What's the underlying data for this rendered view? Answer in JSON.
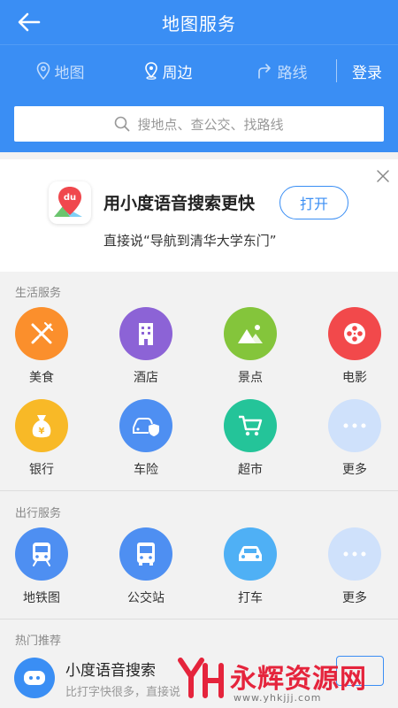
{
  "header": {
    "title": "地图服务",
    "back_icon": "arrow-left-icon"
  },
  "tabs": [
    {
      "label": "地图",
      "icon": "location-pin-icon",
      "active": false
    },
    {
      "label": "周边",
      "icon": "nearby-pin-icon",
      "active": true
    },
    {
      "label": "路线",
      "icon": "route-turn-icon",
      "active": false
    }
  ],
  "login_label": "登录",
  "search": {
    "placeholder": "搜地点、查公交、找路线",
    "icon": "search-icon"
  },
  "promo": {
    "title": "用小度语音搜索更快",
    "subtitle": "直接说“导航到清华大学东门”",
    "button_label": "打开",
    "logo_text": "du"
  },
  "sections": {
    "life": {
      "label": "生活服务",
      "items": [
        {
          "label": "美食",
          "icon": "fork-knife-icon",
          "color": "#fb8f2c"
        },
        {
          "label": "酒店",
          "icon": "building-icon",
          "color": "#8c63d6"
        },
        {
          "label": "景点",
          "icon": "mountain-icon",
          "color": "#84c53b"
        },
        {
          "label": "电影",
          "icon": "film-reel-icon",
          "color": "#f2494b"
        },
        {
          "label": "银行",
          "icon": "money-bag-icon",
          "color": "#f8b927"
        },
        {
          "label": "车险",
          "icon": "car-shield-icon",
          "color": "#4e8ff2"
        },
        {
          "label": "超市",
          "icon": "cart-icon",
          "color": "#24c499"
        },
        {
          "label": "更多",
          "icon": "more-dots-icon",
          "color": "#cfe1fb"
        }
      ]
    },
    "travel": {
      "label": "出行服务",
      "items": [
        {
          "label": "地铁图",
          "icon": "subway-icon",
          "color": "#4e8ff2"
        },
        {
          "label": "公交站",
          "icon": "bus-icon",
          "color": "#4e8ff2"
        },
        {
          "label": "打车",
          "icon": "taxi-icon",
          "color": "#4fb0f5"
        },
        {
          "label": "更多",
          "icon": "more-dots-icon",
          "color": "#cfe1fb"
        }
      ]
    },
    "hot": {
      "label": "热门推荐",
      "card": {
        "title": "小度语音搜索",
        "subtitle": "比打字快很多，直接说",
        "icon": "voice-robot-icon"
      }
    }
  },
  "watermark": {
    "text": "永辉资源网",
    "url": "www.yhkjjj.com"
  },
  "colors": {
    "primary": "#3a8ef4"
  }
}
